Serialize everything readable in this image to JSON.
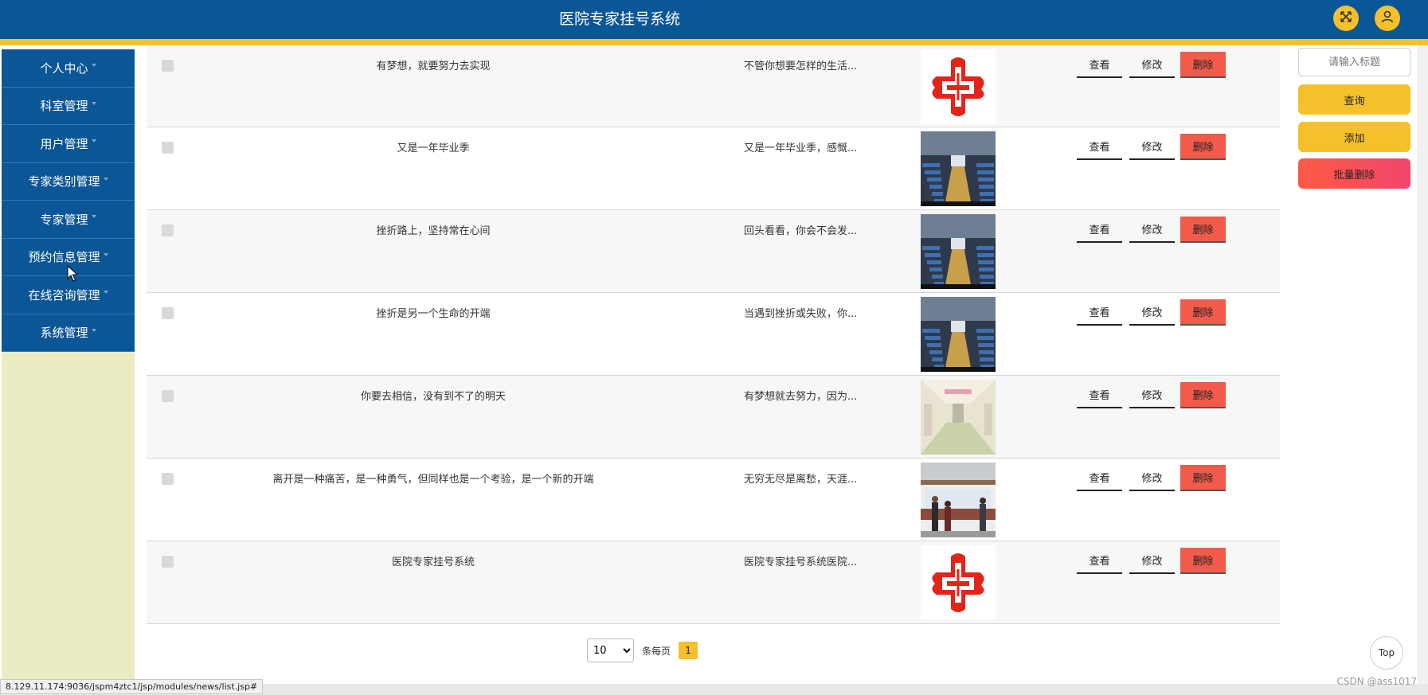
{
  "header": {
    "title": "医院专家挂号系统",
    "fullscreen_icon": "expand-icon",
    "user_icon": "user-icon",
    "accent": "#f5c02a",
    "brand": "#0b5696"
  },
  "sidebar": {
    "items": [
      {
        "label": "个人中心"
      },
      {
        "label": "科室管理"
      },
      {
        "label": "用户管理"
      },
      {
        "label": "专家类别管理"
      },
      {
        "label": "专家管理"
      },
      {
        "label": "预约信息管理"
      },
      {
        "label": "在线咨询管理"
      },
      {
        "label": "系统管理"
      }
    ]
  },
  "table": {
    "actions": {
      "view": "查看",
      "edit": "修改",
      "delete": "删除"
    },
    "rows": [
      {
        "title": "有梦想，就要努力去实现",
        "intro": "不管你想要怎样的生活...",
        "image": "red-cross"
      },
      {
        "title": "又是一年毕业季",
        "intro": "又是一年毕业季，感慨...",
        "image": "waiting-hall"
      },
      {
        "title": "挫折路上，坚持常在心间",
        "intro": "回头看看，你会不会发...",
        "image": "waiting-hall"
      },
      {
        "title": "挫折是另一个生命的开端",
        "intro": "当遇到挫折或失败，你...",
        "image": "waiting-hall"
      },
      {
        "title": "你要去相信，没有到不了的明天",
        "intro": "有梦想就去努力，因为...",
        "image": "corridor"
      },
      {
        "title": "离开是一种痛苦，是一种勇气，但同样也是一个考验，是一个新的开端",
        "intro": "无穷无尽是离愁，天涯...",
        "image": "reception"
      },
      {
        "title": "医院专家挂号系统",
        "intro": "医院专家挂号系统医院...",
        "image": "red-cross"
      }
    ]
  },
  "right_panel": {
    "search_placeholder": "请输入标题",
    "query": "查询",
    "add": "添加",
    "batch_delete": "批量删除"
  },
  "pagination": {
    "page_size": "10",
    "per_page_label": "条每页",
    "current_page": "1"
  },
  "top_button": "Top",
  "status_bar": "8.129.11.174:9036/jspm4ztc1/jsp/modules/news/list.jsp#",
  "watermark": "CSDN @ass1017"
}
